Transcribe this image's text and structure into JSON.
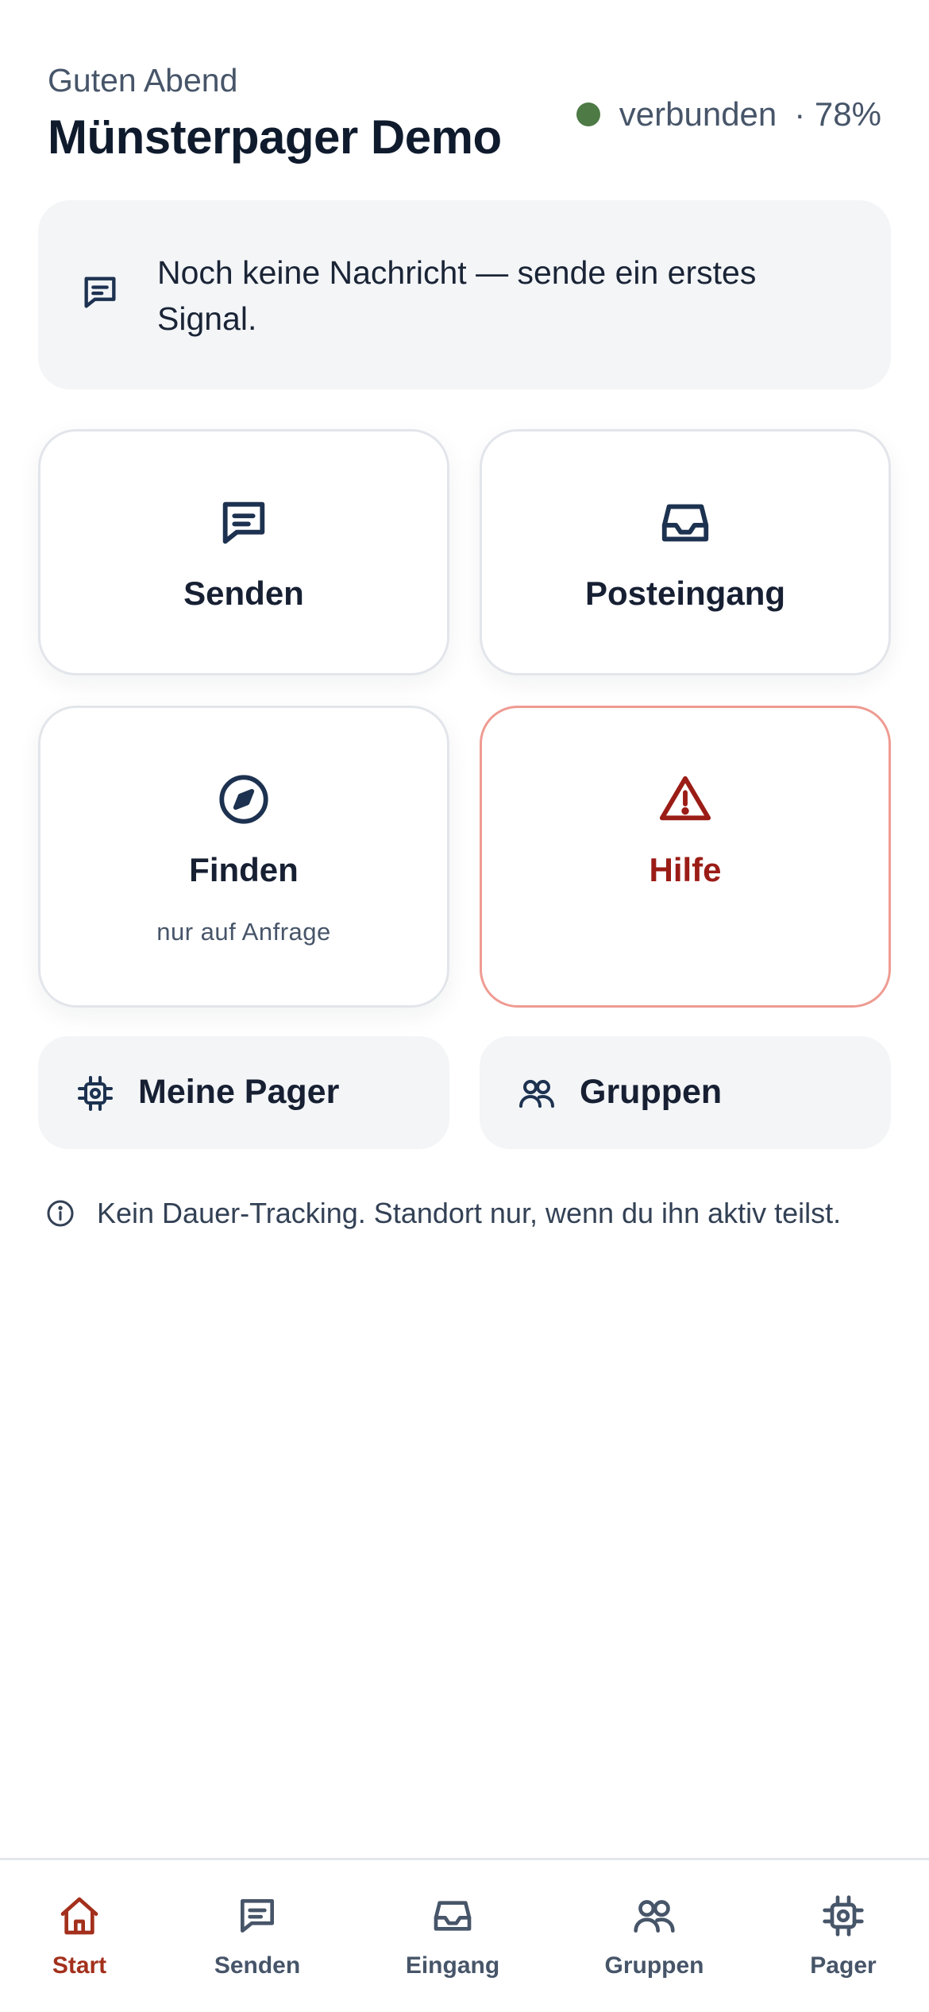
{
  "header": {
    "greeting": "Guten Abend",
    "title": "Münsterpager Demo",
    "status": {
      "connection": "verbunden",
      "battery": "· 78%",
      "dot_color": "#4d7a45"
    }
  },
  "message_card": {
    "icon": "message-icon",
    "text": "Noch keine Nachricht — sende ein erstes Signal."
  },
  "tiles": [
    {
      "icon": "message-icon",
      "label": "Senden",
      "sublabel": ""
    },
    {
      "icon": "inbox-icon",
      "label": "Posteingang",
      "sublabel": ""
    },
    {
      "icon": "compass-icon",
      "label": "Finden",
      "sublabel": "nur auf Anfrage"
    },
    {
      "icon": "warning-icon",
      "label": "Hilfe",
      "sublabel": "",
      "accent": "#9b1c16"
    }
  ],
  "pills": [
    {
      "icon": "chip-icon",
      "label": "Meine Pager"
    },
    {
      "icon": "users-icon",
      "label": "Gruppen"
    }
  ],
  "notice": {
    "icon": "info-icon",
    "text": "Kein Dauer-Tracking. Standort nur, wenn du ihn aktiv teilst."
  },
  "tabbar": {
    "active": "Start",
    "active_color": "#a3301c",
    "items": [
      {
        "icon": "home-icon",
        "label": "Start"
      },
      {
        "icon": "message-icon",
        "label": "Senden"
      },
      {
        "icon": "inbox-icon",
        "label": "Eingang"
      },
      {
        "icon": "users-icon",
        "label": "Gruppen"
      },
      {
        "icon": "chip-icon",
        "label": "Pager"
      }
    ]
  }
}
